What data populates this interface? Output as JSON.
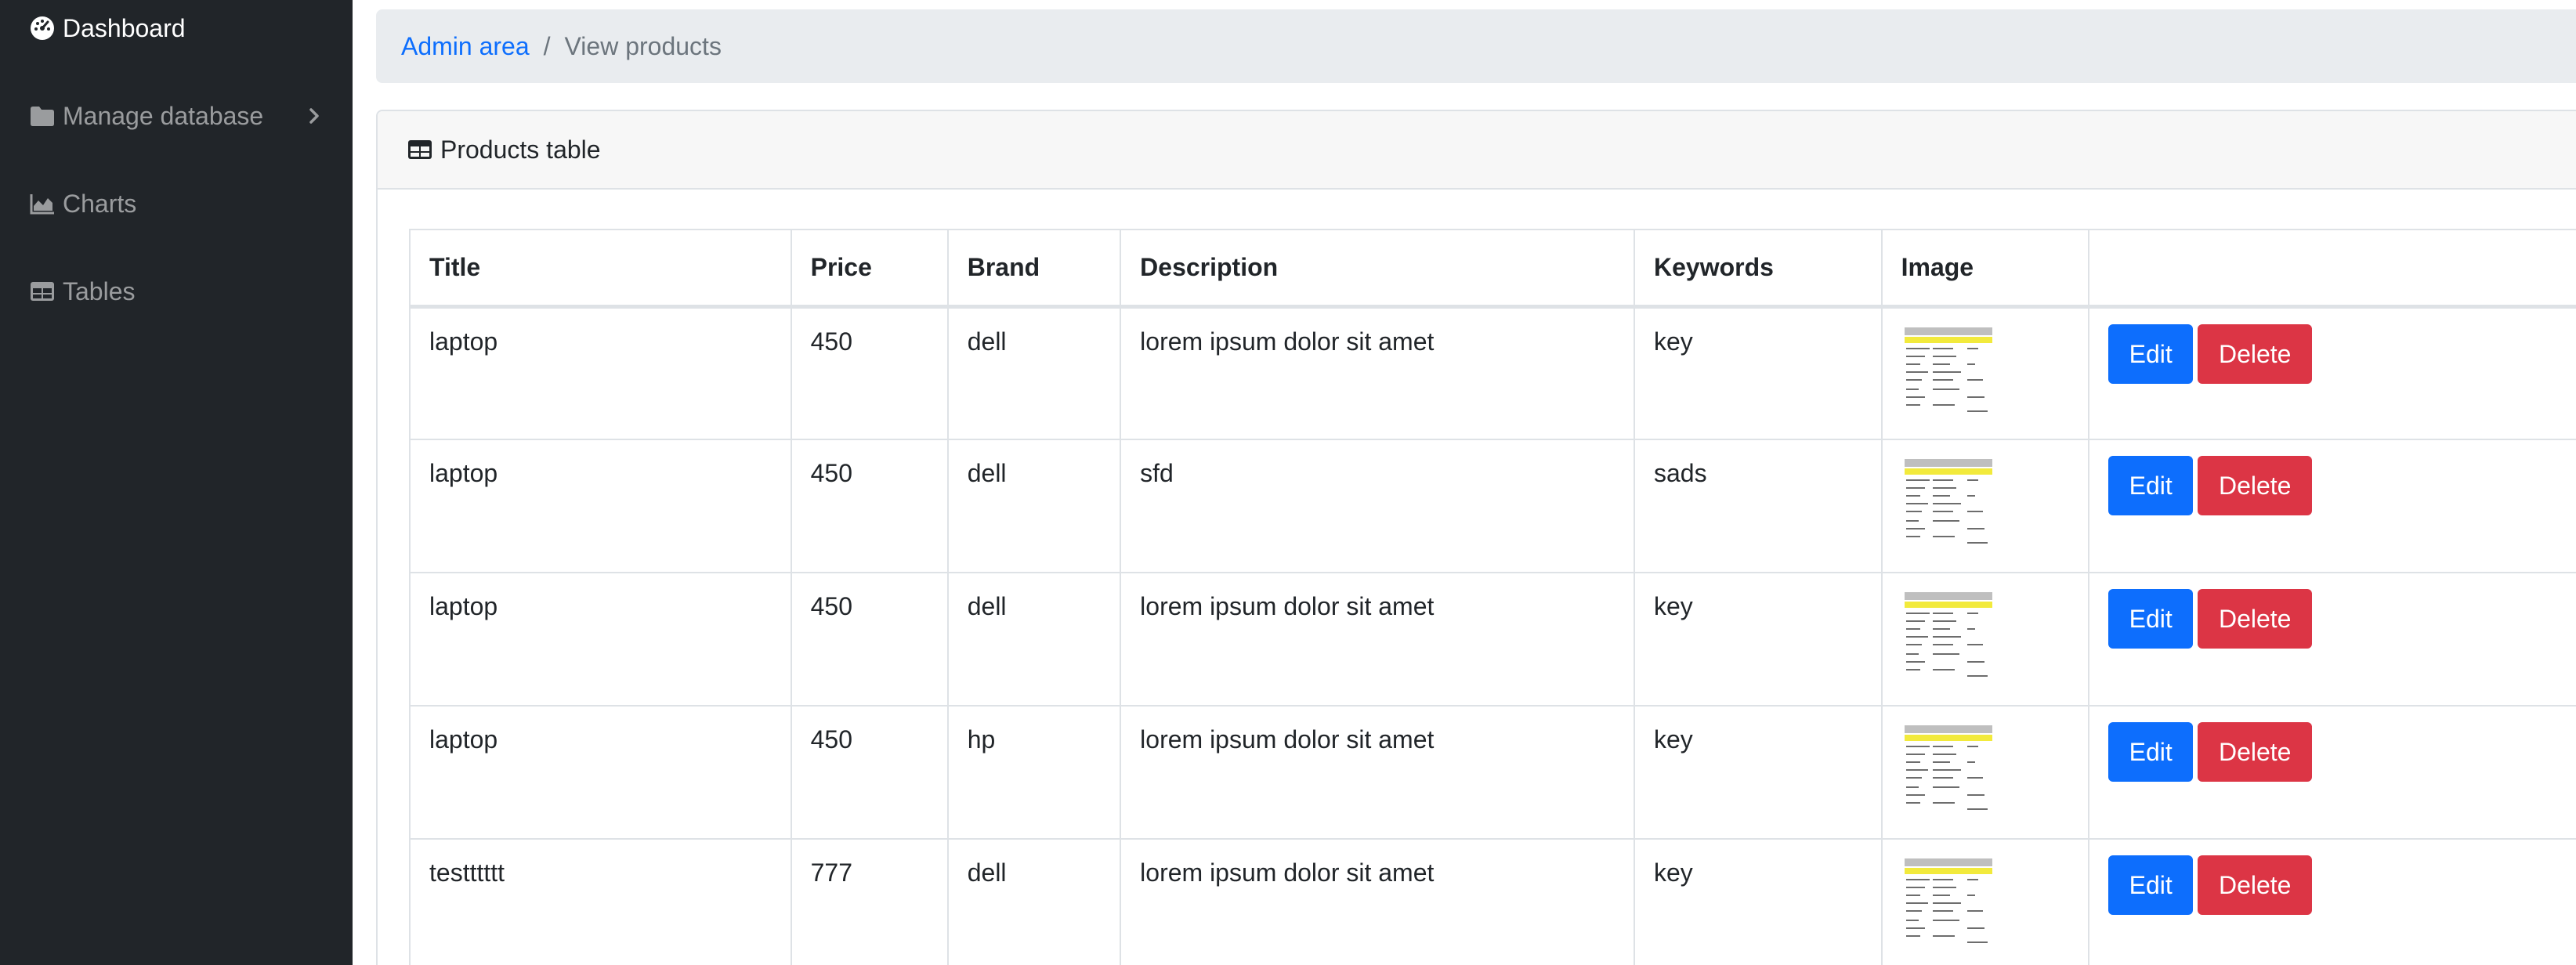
{
  "sidebar": {
    "items": [
      {
        "label": "Dashboard",
        "icon": "gauge-icon",
        "active": true
      },
      {
        "label": "Manage database",
        "icon": "folder-icon",
        "has_submenu": true
      },
      {
        "label": "Charts",
        "icon": "chart-area-icon"
      },
      {
        "label": "Tables",
        "icon": "table-icon"
      }
    ]
  },
  "breadcrumb": {
    "root": "Admin area",
    "separator": "/",
    "current": "View products"
  },
  "card": {
    "title": "Products table",
    "icon": "table-icon"
  },
  "table": {
    "headers": [
      "Title",
      "Price",
      "Brand",
      "Description",
      "Keywords",
      "Image",
      ""
    ],
    "rows": [
      {
        "title": "laptop",
        "price": "450",
        "brand": "dell",
        "description": "lorem ipsum dolor sit amet",
        "keywords": "key"
      },
      {
        "title": "laptop",
        "price": "450",
        "brand": "dell",
        "description": "sfd",
        "keywords": "sads"
      },
      {
        "title": "laptop",
        "price": "450",
        "brand": "dell",
        "description": "lorem ipsum dolor sit amet",
        "keywords": "key"
      },
      {
        "title": "laptop",
        "price": "450",
        "brand": "hp",
        "description": "lorem ipsum dolor sit amet",
        "keywords": "key"
      },
      {
        "title": "testttttt",
        "price": "777",
        "brand": "dell",
        "description": "lorem ipsum dolor sit amet",
        "keywords": "key"
      }
    ],
    "actions": {
      "edit_label": "Edit",
      "delete_label": "Delete"
    }
  },
  "colors": {
    "sidebar_bg": "#212529",
    "link": "#0d6efd",
    "edit_button": "#0d6efd",
    "delete_button": "#dc3545",
    "breadcrumb_bg": "#e9ecef"
  }
}
